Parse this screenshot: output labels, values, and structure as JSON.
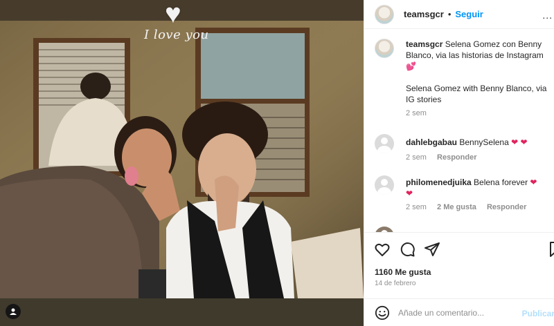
{
  "post": {
    "username": "teamsgcr",
    "follow_label": "Seguir",
    "separator": "•",
    "more_label": "...",
    "sticker_heart": "♥",
    "sticker_caption": "I love you",
    "caption_line1": "teamsgcr",
    "caption_text": "Selena Gomez con Benny Blanco, via las historias de Instagram",
    "caption_emoji": "💕",
    "caption_en": "Selena Gomez with Benny Blanco, via IG stories",
    "caption_time": "2 sem"
  },
  "comments": [
    {
      "user": "dahlebgabau",
      "text": "BennySelena",
      "hearts": "❤ ❤",
      "time": "2 sem",
      "likes": "",
      "reply": "Responder"
    },
    {
      "user": "philomenedjuika",
      "text": "Belena forever",
      "hearts": "❤",
      "hearts2": "❤",
      "time": "2 sem",
      "likes": "2 Me gusta",
      "reply": "Responder"
    }
  ],
  "stats": {
    "likes": "1160 Me gusta",
    "date": "14 de febrero"
  },
  "composer": {
    "placeholder": "Añade un comentario...",
    "publish_label": "Publicar"
  },
  "colors": {
    "accent": "#0095f6",
    "heart": "#e0245e",
    "muted": "#8e8e8e"
  }
}
